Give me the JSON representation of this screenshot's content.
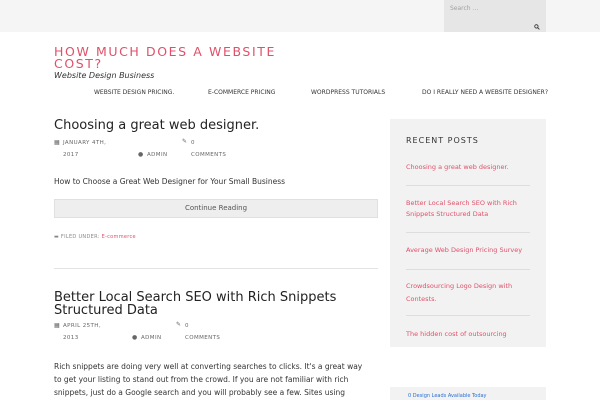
{
  "search": {
    "placeholder": "Search ..."
  },
  "site": {
    "title": "HOW MUCH DOES A WEBSITE COST?",
    "description": "Website Design Business"
  },
  "nav": {
    "items": [
      "WEBSITE DESIGN PRICING.",
      "E-COMMERCE PRICING",
      "WORDPRESS TUTORIALS",
      "DO I REALLY NEED A WEBSITE DESIGNER?"
    ]
  },
  "posts": [
    {
      "title": "Choosing a great web designer.",
      "date_month_day": "JANUARY 4TH,",
      "date_year": "2017",
      "author": "ADMIN",
      "comments_count": "0",
      "comments_label": "COMMENTS",
      "excerpt": "How to Choose a Great Web Designer for Your Small Business",
      "continue_label": "Continue Reading",
      "filed_label": "FILED UNDER:",
      "category": "E-commerce"
    },
    {
      "title_line1": "Better Local Search SEO with Rich Snippets",
      "title_line2": "Structured Data",
      "date_month_day": "APRIL 25TH,",
      "date_year": "2013",
      "author": "ADMIN",
      "comments_count": "0",
      "comments_label": "COMMENTS",
      "excerpt_lines": [
        "Rich snippets are doing very well at converting searches to clicks. It's a great way",
        "to get your listing to stand out from the crowd. If you are not familiar with rich",
        "snippets, just do a Google search and you will probably see a few. Sites using"
      ]
    }
  ],
  "sidebar": {
    "heading": "RECENT POSTS",
    "recent": [
      {
        "lines": [
          "Choosing a great web designer."
        ]
      },
      {
        "lines": [
          "Better Local Search SEO with Rich",
          "Snippets Structured Data"
        ]
      },
      {
        "lines": [
          "Average Web Design Pricing Survey"
        ]
      },
      {
        "lines": [
          "Crowdsourcing Logo Design with",
          "Contests."
        ]
      },
      {
        "lines": [
          "The hidden cost of outsourcing"
        ]
      }
    ],
    "leads": "0 Design Leads Available Today"
  },
  "colors": {
    "accent": "#e0506a",
    "link_blue": "#2a6fd6",
    "sidebar_bg": "#f2f2f2"
  },
  "icons": {
    "search": "search-icon",
    "calendar": "calendar-icon",
    "user": "user-icon",
    "comments": "pencil-icon",
    "folder": "folder-icon"
  }
}
